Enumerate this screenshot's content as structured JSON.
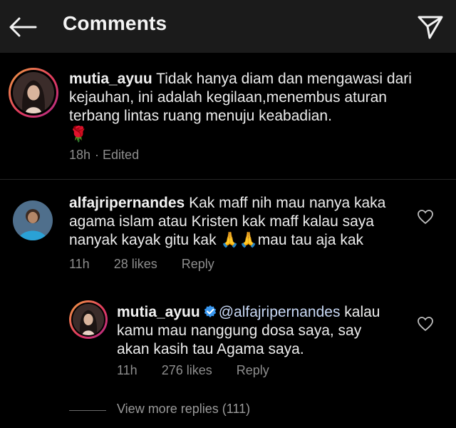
{
  "header": {
    "title": "Comments"
  },
  "caption": {
    "username": "mutia_ayuu",
    "text": "Tidak hanya diam dan mengawasi dari kejauhan, ini adalah kegilaan,menembus aturan terbang lintas ruang menuju keabadian.",
    "emoji": "🌹",
    "time": "18h",
    "edited": "· Edited"
  },
  "comment": {
    "username": "alfajripernandes",
    "text_line1": "Kak maff nih mau nanya kaka",
    "text_line2": "agama islam atau Kristen kak maff kalau saya",
    "text_line3_a": "nanyak kayak gitu kak ",
    "text_line3_emoji": "🙏🙏",
    "text_line3_b": "mau tau aja kak",
    "time": "11h",
    "likes": "28 likes",
    "reply": "Reply"
  },
  "reply": {
    "username": "mutia_ayuu",
    "mention": "@alfajripernandes",
    "text_line1_tail": " kalau",
    "text_line2": "kamu mau nanggung dosa saya, say",
    "text_line3": "akan kasih tau Agama saya.",
    "time": "11h",
    "likes": "276 likes",
    "reply": "Reply"
  },
  "view_more": "View more replies (111)",
  "colors": {
    "header_bg": "#1b1b1b",
    "background": "#000000",
    "meta_text": "#8e8e8e",
    "verified_blue": "#3897f0",
    "ring_gradient": [
      "#f0a143",
      "#e03a5e",
      "#b02b86"
    ]
  }
}
